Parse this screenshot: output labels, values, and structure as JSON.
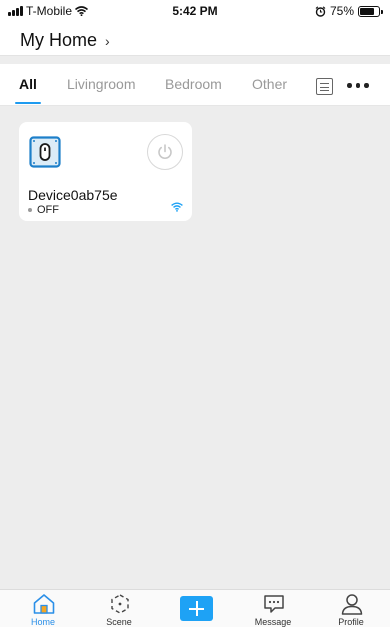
{
  "status_bar": {
    "carrier": "T-Mobile",
    "time": "5:42 PM",
    "battery": "75%",
    "battery_level": 0.75
  },
  "header": {
    "title": "My Home",
    "chevron": "›"
  },
  "tabs": [
    {
      "label": "All",
      "active": true
    },
    {
      "label": "Livingroom",
      "active": false
    },
    {
      "label": "Bedroom",
      "active": false
    },
    {
      "label": "Other",
      "active": false
    }
  ],
  "tab_actions": {
    "list_icon": "list-icon",
    "more_icon": "more-icon"
  },
  "devices": [
    {
      "name": "Device0ab75e",
      "status": "OFF",
      "icon": "smart-plug-icon",
      "power_icon": "power-icon",
      "connection_icon": "wifi-icon"
    }
  ],
  "bottom_nav": [
    {
      "label": "Home",
      "icon": "home-icon",
      "active": true
    },
    {
      "label": "Scene",
      "icon": "scene-icon",
      "active": false
    },
    {
      "label": "",
      "icon": "add-icon",
      "active": false
    },
    {
      "label": "Message",
      "icon": "message-icon",
      "active": false
    },
    {
      "label": "Profile",
      "icon": "profile-icon",
      "active": false
    }
  ],
  "colors": {
    "accent": "#1ea2f5",
    "active_nav": "#2a8fe8",
    "background": "#ededed"
  }
}
